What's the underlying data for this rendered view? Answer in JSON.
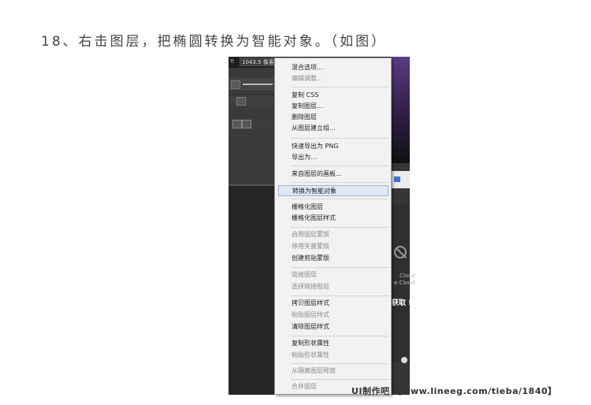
{
  "step_title": "18、右击图层，把椭圆转换为智能对象。（如图）",
  "ps": {
    "y_label": "Y:",
    "size_value": "1043.5 像素",
    "cloud_line1": "Cloud",
    "cloud_line2": "e Cloud",
    "get_label": "获取 !"
  },
  "context_menu": {
    "items": [
      {
        "label": "混合选项...",
        "enabled": true
      },
      {
        "label": "编辑调整...",
        "enabled": false
      },
      {
        "label": "复制 CSS",
        "enabled": true
      },
      {
        "label": "复制图层...",
        "enabled": true
      },
      {
        "label": "删除图层",
        "enabled": true
      },
      {
        "label": "从图层建立组...",
        "enabled": true
      },
      {
        "label": "快速导出为 PNG",
        "enabled": true
      },
      {
        "label": "导出为...",
        "enabled": true
      },
      {
        "label": "来自图层的画板...",
        "enabled": true
      },
      {
        "label": "转换为智能对象",
        "enabled": true,
        "highlighted": true
      },
      {
        "label": "栅格化图层",
        "enabled": true
      },
      {
        "label": "栅格化图层样式",
        "enabled": true
      },
      {
        "label": "启用图层蒙版",
        "enabled": false
      },
      {
        "label": "停用矢量蒙版",
        "enabled": false
      },
      {
        "label": "创建剪贴蒙版",
        "enabled": true
      },
      {
        "label": "链接图层",
        "enabled": false
      },
      {
        "label": "选择链接图层",
        "enabled": false
      },
      {
        "label": "拷贝图层样式",
        "enabled": true
      },
      {
        "label": "粘贴图层样式",
        "enabled": false
      },
      {
        "label": "清除图层样式",
        "enabled": true
      },
      {
        "label": "复制形状属性",
        "enabled": true
      },
      {
        "label": "粘贴形状属性",
        "enabled": false
      },
      {
        "label": "从隔离图层释放",
        "enabled": false
      },
      {
        "label": "合并图层",
        "enabled": false
      }
    ]
  },
  "watermark": "UI制作吧  【www.lineeg.com/tieba/1840】"
}
